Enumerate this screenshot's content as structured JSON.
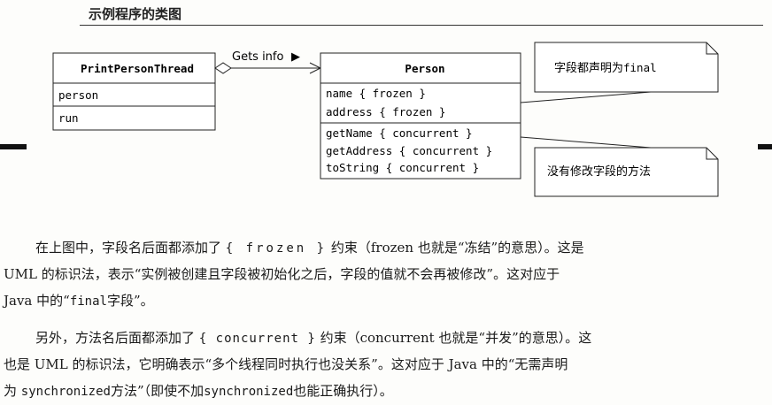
{
  "page": {
    "title": "示例程序的类图"
  },
  "diagram": {
    "class_left": {
      "name": "PrintPersonThread",
      "fields": [
        "person"
      ],
      "methods": [
        "run"
      ]
    },
    "association": {
      "label": "Gets info",
      "direction_arrow": "▶"
    },
    "class_right": {
      "name": "Person",
      "fields": [
        "name { frozen }",
        "address { frozen }"
      ],
      "methods": [
        "getName { concurrent }",
        "getAddress { concurrent }",
        "toString { concurrent }"
      ]
    },
    "notes": [
      {
        "prefix": "字段都声明为",
        "code": "final"
      },
      {
        "text": "没有修改字段的方法"
      }
    ]
  },
  "body": {
    "p1": {
      "l1_a": "在上图中，字段名后面都添加了",
      "l1_code": "{ frozen }",
      "l1_b": "约束（frozen 也就是“冻结”的意思）。这是",
      "l2": "UML 的标识法，表示“实例被创建且字段被初始化之后，字段的值就不会再被修改”。这对应于",
      "l3_a": "Java 中的“",
      "l3_code": "final",
      "l3_b": "字段”。"
    },
    "p2": {
      "l1_a": "另外，方法名后面都添加了",
      "l1_code": "{ concurrent }",
      "l1_b": "约束（concurrent 也就是“并发”的意思）。这",
      "l2": "也是 UML 的标识法，它明确表示“多个线程同时执行也没关系”。这对应于 Java 中的“无需声明",
      "l3_a": "为",
      "l3_code1": "synchronized",
      "l3_b": "方法”（即使不加",
      "l3_code2": "synchronized",
      "l3_c": "也能正确执行）。"
    }
  }
}
